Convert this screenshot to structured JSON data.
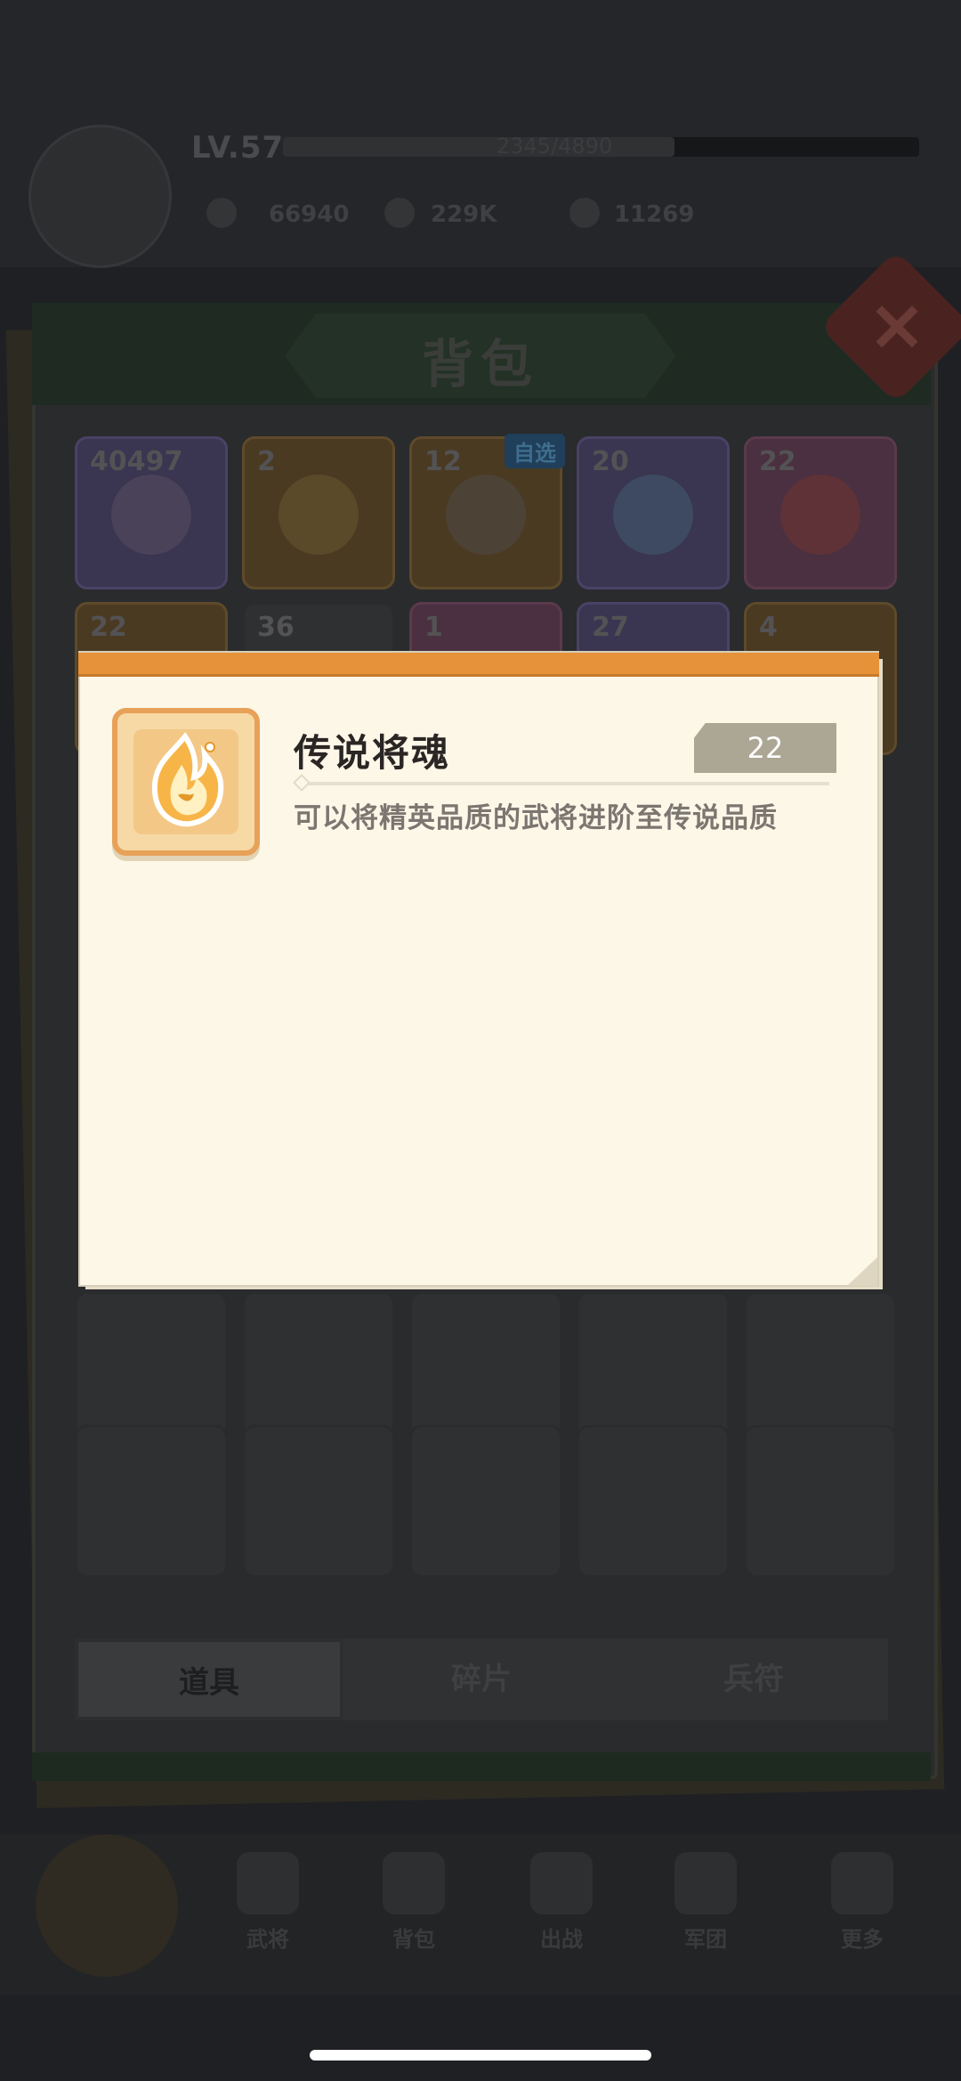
{
  "player": {
    "level_label": "LV.57",
    "exp_text": "2345/4890",
    "resources": [
      {
        "icon": "gem-icon",
        "value": "66940"
      },
      {
        "icon": "coin-icon",
        "value": "229K"
      },
      {
        "icon": "food-icon",
        "value": "11269"
      }
    ]
  },
  "bag": {
    "title": "背包",
    "close_icon": "close-icon",
    "row1": [
      {
        "count": "40497",
        "tag": "",
        "color": "purple"
      },
      {
        "count": "2",
        "tag": "",
        "color": "orange"
      },
      {
        "count": "12",
        "tag": "自选",
        "color": "orange"
      },
      {
        "count": "20",
        "tag": "",
        "color": "purple"
      },
      {
        "count": "22",
        "tag": "",
        "color": "pink"
      }
    ],
    "row2": [
      {
        "count": "22",
        "tag": "",
        "color": "orange"
      },
      {
        "count": "36",
        "tag": "",
        "color": "gray"
      },
      {
        "count": "1",
        "tag": "",
        "color": "pink"
      },
      {
        "count": "27",
        "tag": "",
        "color": "purple"
      },
      {
        "count": "4",
        "tag": "",
        "color": "orange"
      }
    ],
    "tabs": [
      {
        "label": "道具",
        "active": true
      },
      {
        "label": "碎片",
        "active": false
      },
      {
        "label": "兵符",
        "active": false
      }
    ]
  },
  "nav": [
    {
      "label": "",
      "icon": "main-menu-icon"
    },
    {
      "label": "武将",
      "icon": "hero-icon"
    },
    {
      "label": "背包",
      "icon": "bag-icon"
    },
    {
      "label": "出战",
      "icon": "battle-icon"
    },
    {
      "label": "军团",
      "icon": "legion-icon"
    },
    {
      "label": "更多",
      "icon": "more-icon"
    }
  ],
  "item_detail": {
    "name": "传说将魂",
    "count": "22",
    "description": "可以将精英品质的武将进阶至传说品质",
    "icon": "legendary-soul-flame-icon",
    "accent_color": "#e6923a"
  }
}
